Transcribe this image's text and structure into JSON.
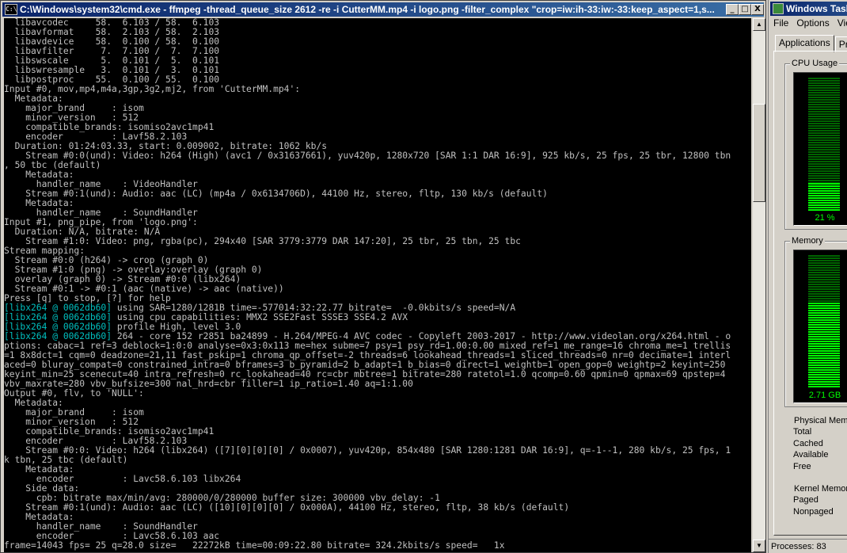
{
  "cmd": {
    "title": "C:\\Windows\\system32\\cmd.exe - ffmpeg  -thread_queue_size 2612 -re -i CutterMM.mp4 -i logo.png -filter_complex \"crop=iw:ih-33:iw:-33:keep_aspect=1,s...",
    "icon_text": "C:\\",
    "buttons": {
      "minimize": "_",
      "maximize": "□",
      "close": "X"
    },
    "lines": [
      {
        "text": "  libavcodec     58.  6.103 / 58.  6.103"
      },
      {
        "text": "  libavformat    58.  2.103 / 58.  2.103"
      },
      {
        "text": "  libavdevice    58.  0.100 / 58.  0.100"
      },
      {
        "text": "  libavfilter     7.  7.100 /  7.  7.100"
      },
      {
        "text": "  libswscale      5.  0.101 /  5.  0.101"
      },
      {
        "text": "  libswresample   3.  0.101 /  3.  0.101"
      },
      {
        "text": "  libpostproc    55.  0.100 / 55.  0.100"
      },
      {
        "text": "Input #0, mov,mp4,m4a,3gp,3g2,mj2, from 'CutterMM.mp4':"
      },
      {
        "text": "  Metadata:"
      },
      {
        "text": "    major_brand     : isom"
      },
      {
        "text": "    minor_version   : 512"
      },
      {
        "text": "    compatible_brands: isomiso2avc1mp41"
      },
      {
        "text": "    encoder         : Lavf58.2.103"
      },
      {
        "text": "  Duration: 01:24:03.33, start: 0.009002, bitrate: 1062 kb/s"
      },
      {
        "text": "    Stream #0:0(und): Video: h264 (High) (avc1 / 0x31637661), yuv420p, 1280x720 [SAR 1:1 DAR 16:9], 925 kb/s, 25 fps, 25 tbr, 12800 tbn"
      },
      {
        "text": ", 50 tbc (default)"
      },
      {
        "text": "    Metadata:"
      },
      {
        "text": "      handler_name    : VideoHandler"
      },
      {
        "text": "    Stream #0:1(und): Audio: aac (LC) (mp4a / 0x6134706D), 44100 Hz, stereo, fltp, 130 kb/s (default)"
      },
      {
        "text": "    Metadata:"
      },
      {
        "text": "      handler_name    : SoundHandler"
      },
      {
        "text": "Input #1, png_pipe, from 'logo.png':"
      },
      {
        "text": "  Duration: N/A, bitrate: N/A"
      },
      {
        "text": "    Stream #1:0: Video: png, rgba(pc), 294x40 [SAR 3779:3779 DAR 147:20], 25 tbr, 25 tbn, 25 tbc"
      },
      {
        "text": "Stream mapping:"
      },
      {
        "text": "  Stream #0:0 (h264) -> crop (graph 0)"
      },
      {
        "text": "  Stream #1:0 (png) -> overlay:overlay (graph 0)"
      },
      {
        "text": "  overlay (graph 0) -> Stream #0:0 (libx264)"
      },
      {
        "text": "  Stream #0:1 -> #0:1 (aac (native) -> aac (native))"
      },
      {
        "text": "Press [q] to stop, [?] for help"
      },
      {
        "tag": "[libx264 @ 0062db60]",
        "text": " using SAR=1280/1281B time=-577014:32:22.77 bitrate=  -0.0kbits/s speed=N/A"
      },
      {
        "tag": "[libx264 @ 0062db60]",
        "text": " using cpu capabilities: MMX2 SSE2Fast SSSE3 SSE4.2 AVX"
      },
      {
        "tag": "[libx264 @ 0062db60]",
        "text": " profile High, level 3.0"
      },
      {
        "tag": "[libx264 @ 0062db60]",
        "text": " 264 - core 152 r2851 ba24899 - H.264/MPEG-4 AVC codec - Copyleft 2003-2017 - http://www.videolan.org/x264.html - o"
      },
      {
        "text": "ptions: cabac=1 ref=3 deblock=1:0:0 analyse=0x3:0x113 me=hex subme=7 psy=1 psy_rd=1.00:0.00 mixed_ref=1 me_range=16 chroma_me=1 trellis"
      },
      {
        "text": "=1 8x8dct=1 cqm=0 deadzone=21,11 fast_pskip=1 chroma_qp_offset=-2 threads=6 lookahead_threads=1 sliced_threads=0 nr=0 decimate=1 interl"
      },
      {
        "text": "aced=0 bluray_compat=0 constrained_intra=0 bframes=3 b_pyramid=2 b_adapt=1 b_bias=0 direct=1 weightb=1 open_gop=0 weightp=2 keyint=250"
      },
      {
        "text": "keyint_min=25 scenecut=40 intra_refresh=0 rc_lookahead=40 rc=cbr mbtree=1 bitrate=280 ratetol=1.0 qcomp=0.60 qpmin=0 qpmax=69 qpstep=4"
      },
      {
        "text": "vbv_maxrate=280 vbv_bufsize=300 nal_hrd=cbr filler=1 ip_ratio=1.40 aq=1:1.00"
      },
      {
        "text": "Output #0, flv, to 'NULL':"
      },
      {
        "text": "  Metadata:"
      },
      {
        "text": "    major_brand     : isom"
      },
      {
        "text": "    minor_version   : 512"
      },
      {
        "text": "    compatible_brands: isomiso2avc1mp41"
      },
      {
        "text": "    encoder         : Lavf58.2.103"
      },
      {
        "text": "    Stream #0:0: Video: h264 (libx264) ([7][0][0][0] / 0x0007), yuv420p, 854x480 [SAR 1280:1281 DAR 16:9], q=-1--1, 280 kb/s, 25 fps, 1"
      },
      {
        "text": "k tbn, 25 tbc (default)"
      },
      {
        "text": "    Metadata:"
      },
      {
        "text": "      encoder         : Lavc58.6.103 libx264"
      },
      {
        "text": "    Side data:"
      },
      {
        "text": "      cpb: bitrate max/min/avg: 280000/0/280000 buffer size: 300000 vbv_delay: -1"
      },
      {
        "text": "    Stream #0:1(und): Audio: aac (LC) ([10][0][0][0] / 0x000A), 44100 Hz, stereo, fltp, 38 kb/s (default)"
      },
      {
        "text": "    Metadata:"
      },
      {
        "text": "      handler_name    : SoundHandler"
      },
      {
        "text": "      encoder         : Lavc58.6.103 aac"
      },
      {
        "text": "frame=14043 fps= 25 q=28.0 size=   22272kB time=00:09:22.80 bitrate= 324.2kbits/s speed=   1x"
      }
    ]
  },
  "colors": {
    "terminal_bg": "#000000",
    "terminal_fg": "#c0c0c0",
    "tag": "#00c0c0",
    "meter_on": "#00ff00"
  },
  "taskmgr": {
    "title": "Windows Task",
    "menu": [
      "File",
      "Options",
      "View"
    ],
    "tabs": [
      "Applications",
      "Pro"
    ],
    "cpu": {
      "label": "CPU Usage",
      "value_text": "21 %",
      "fraction": 0.21
    },
    "memory": {
      "label": "Memory",
      "value_text": "2.71 GB",
      "fraction": 0.64
    },
    "physical_memory": {
      "label": "Physical Memo",
      "rows": [
        "Total",
        "Cached",
        "Available",
        "Free"
      ]
    },
    "kernel_memory": {
      "label": "Kernel Memory",
      "rows": [
        "Paged",
        "Nonpaged"
      ]
    },
    "status": "Processes: 83"
  }
}
